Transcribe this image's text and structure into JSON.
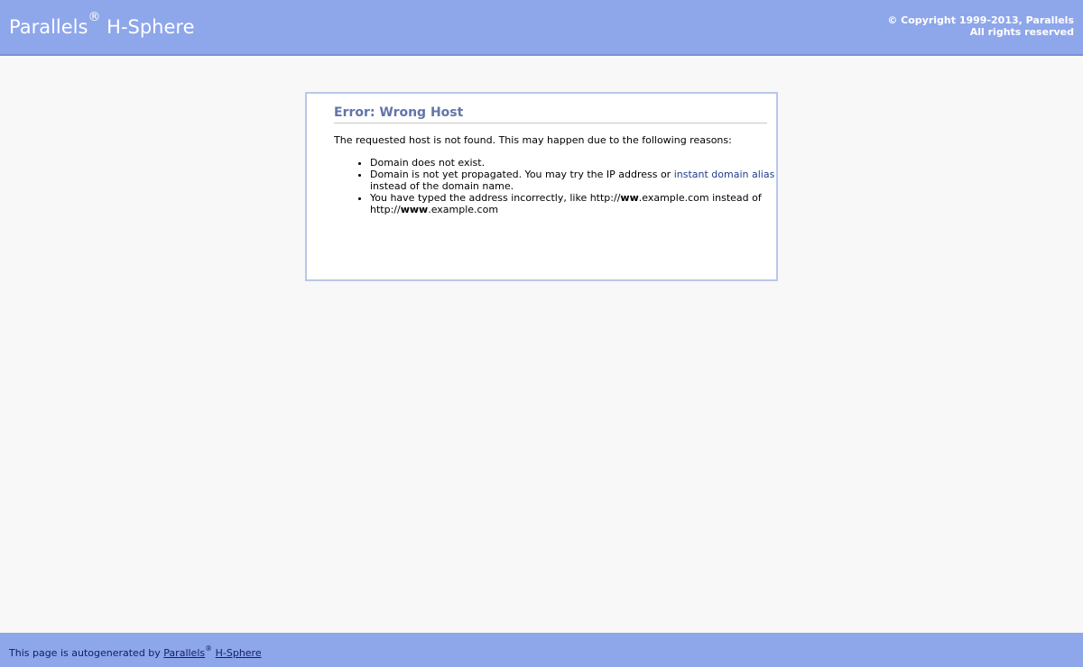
{
  "header": {
    "brand_name": "Parallels",
    "brand_reg": "®",
    "brand_product": "H-Sphere",
    "copyright_line1": "© Copyright 1999-2013, Parallels",
    "copyright_line2": "All rights reserved"
  },
  "error": {
    "title": "Error: Wrong Host",
    "intro": "The requested host is not found. This may happen due to the following reasons:",
    "reason1": "Domain does not exist.",
    "reason2_before": "Domain is not yet propagated. You may try the IP address or ",
    "reason2_link": "instant domain alias",
    "reason2_after": " instead of the domain name.",
    "reason3_part1": "You have typed the address incorrectly, like http://",
    "reason3_bold1": "ww",
    "reason3_part2": ".example.com instead of http://",
    "reason3_bold2": "www",
    "reason3_part3": ".example.com"
  },
  "footer": {
    "text_before": "This page is autogenerated by ",
    "link_parallels": "Parallels",
    "reg": "®",
    "space": " ",
    "link_hsphere": "H-Sphere"
  },
  "colors": {
    "header_bg": "#8ea6ea",
    "title_color": "#6175a8",
    "link_color": "#1f3d8a"
  }
}
